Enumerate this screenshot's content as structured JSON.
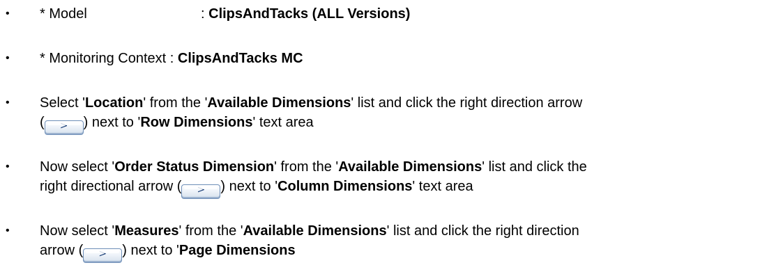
{
  "bullet_symbol": "•",
  "items": [
    {
      "label": "* Model",
      "separator": ": ",
      "value": "ClipsAndTacks (ALL Versions)"
    },
    {
      "label": "* Monitoring Context",
      "separator": " : ",
      "value": "ClipsAndTacks MC"
    },
    {
      "t1": "Select '",
      "b1": "Location",
      "t2": "' from the '",
      "b2": "Available Dimensions",
      "t3": "' list and click the right direction arrow",
      "t4": "(",
      "arrow": ">",
      "t5": ") next to '",
      "b3": "Row Dimensions",
      "t6": "' text area"
    },
    {
      "t1": "Now select '",
      "b1": "Order Status Dimension",
      "t2": "' from the '",
      "b2": "Available Dimensions",
      "t3": "' list and click the",
      "t4": "right directional arrow (",
      "arrow": ">",
      "t5": ") next to '",
      "b3": "Column Dimensions",
      "t6": "' text area"
    },
    {
      "t1": "Now select '",
      "b1": "Measures",
      "t2": "' from the '",
      "b2": "Available Dimensions",
      "t3": "' list and click the right direction",
      "t4": "arrow (",
      "arrow": ">",
      "t5": ") next to '",
      "b3": "Page Dimensions"
    }
  ]
}
